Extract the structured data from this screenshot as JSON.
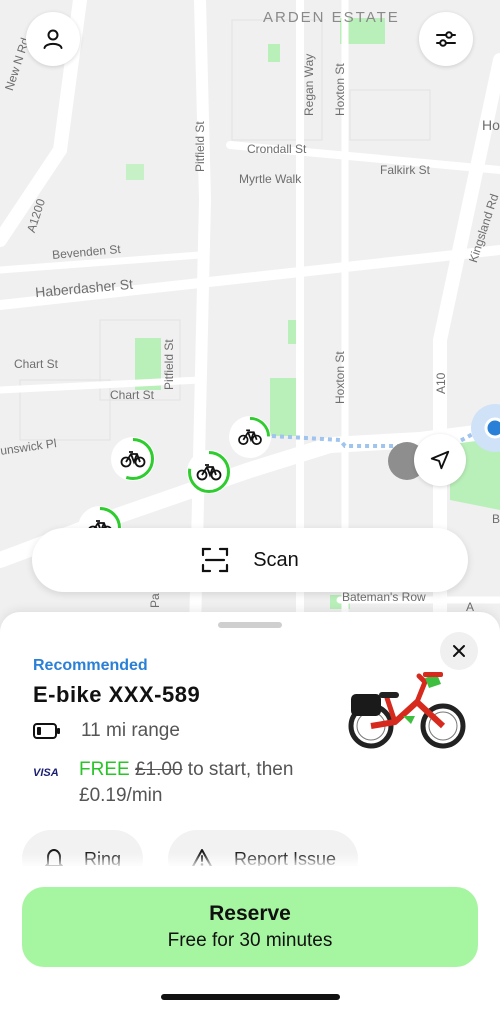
{
  "map": {
    "district_label": "ARDEN ESTATE",
    "street_labels": {
      "new_n_rd": "New N Rd",
      "a1200": "A1200",
      "pitfield_st_north": "Pitfield St",
      "regan_way": "Regan Way",
      "hoxton_st_north": "Hoxton St",
      "crondall_st": "Crondall St",
      "myrtle_walk": "Myrtle Walk",
      "falkirk_st": "Falkirk St",
      "kingsland_rd": "Kingsland Rd",
      "ho": "Ho",
      "bevenden_st": "Bevenden St",
      "haberdasher_st": "Haberdasher St",
      "chart_st_west": "Chart St",
      "chart_st": "Chart St",
      "pitfield_st_south": "Pitfield St",
      "hoxton_st_south": "Hoxton St",
      "a10": "A10",
      "brunswick_pl": "unswick Pl",
      "batemans_row": "Bateman's Row",
      "b": "B",
      "pa": "Pa",
      "a": "A"
    },
    "markers": {
      "bike_icon": "bicycle-icon",
      "accent_color": "#2ecc2e"
    },
    "icons": {
      "profile": "person-icon",
      "filters": "sliders-icon",
      "locate": "navigation-arrow-icon"
    }
  },
  "scan": {
    "label": "Scan",
    "icon": "scan-frame-icon"
  },
  "sheet": {
    "recommended": "Recommended",
    "bike_name": "E-bike XXX-589",
    "range": "11 mi range",
    "payment_brand": "VISA",
    "price": {
      "free": "FREE",
      "original": "£1.00",
      "rest": "to start, then £0.19/min"
    },
    "actions": {
      "ring": "Ring",
      "report_issue": "Report Issue"
    },
    "close_icon": "close-icon"
  },
  "reserve": {
    "label": "Reserve",
    "sublabel": "Free for 30 minutes",
    "color": "#a6f5a0"
  },
  "colors": {
    "recommended_blue": "#2a7fd6",
    "free_green": "#28c428",
    "bike_red": "#d62a1e",
    "bike_green": "#3fbf3f"
  }
}
